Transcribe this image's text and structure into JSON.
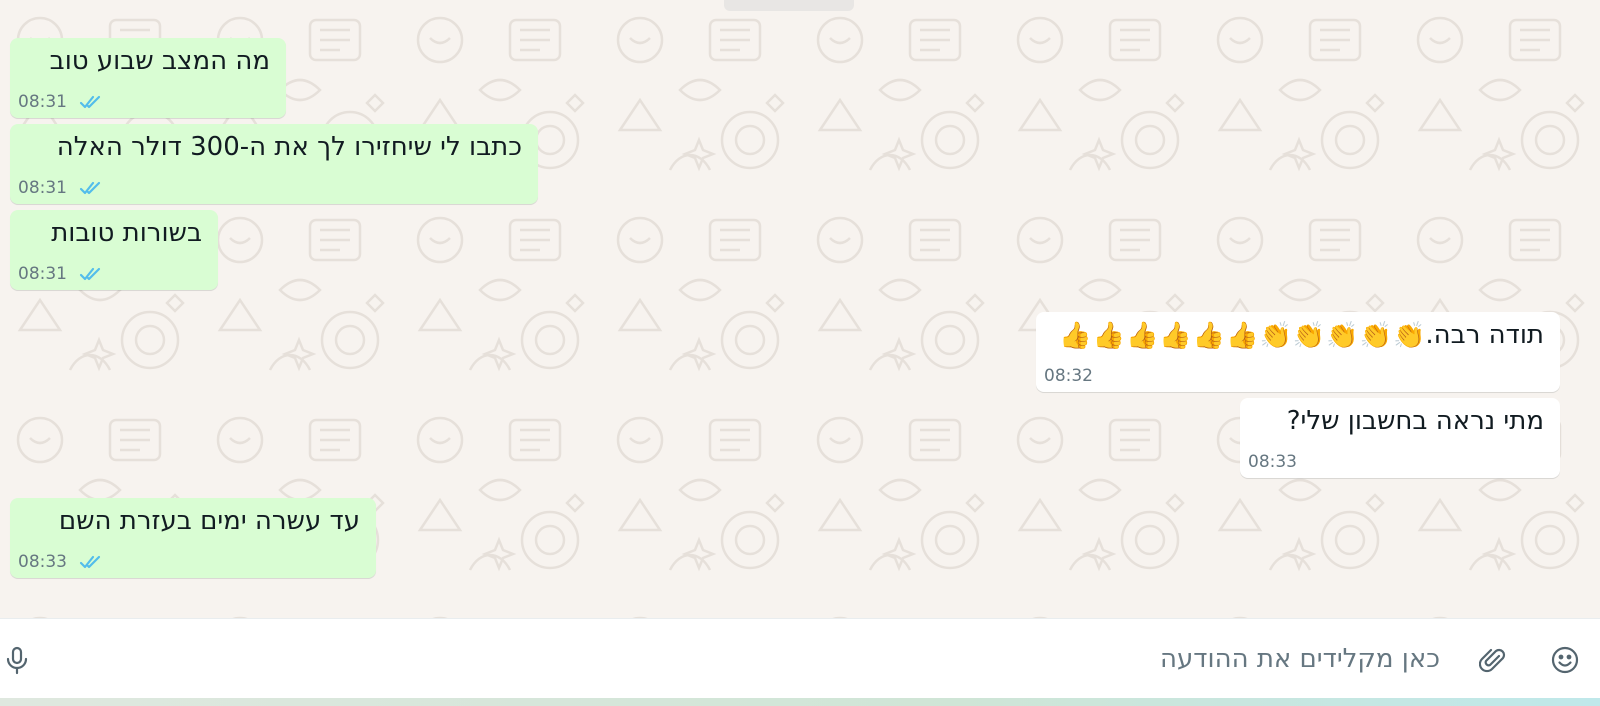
{
  "messages": [
    {
      "text": "מה המצב שבוע טוב",
      "time": "08:31",
      "direction": "outgoing",
      "status": "read"
    },
    {
      "text": "כתבו לי שיחזירו לך את ה-300 דולר האלה",
      "time": "08:31",
      "direction": "outgoing",
      "status": "read"
    },
    {
      "text": "בשורות טובות",
      "time": "08:31",
      "direction": "outgoing",
      "status": "read"
    },
    {
      "text": "תודה רבה.",
      "emoji": [
        "👏",
        "👏",
        "👏",
        "👏",
        "👏",
        "👍",
        "👍",
        "👍",
        "👍",
        "👍",
        "👍"
      ],
      "time": "08:32",
      "direction": "incoming"
    },
    {
      "text": "מתי נראה בחשבון שלי?",
      "time": "08:33",
      "direction": "incoming"
    },
    {
      "text": "עד עשרה ימים בעזרת השם",
      "time": "08:33",
      "direction": "outgoing",
      "status": "read"
    }
  ],
  "composer": {
    "placeholder": "כאן מקלידים את ההודעה",
    "icons": {
      "emoji": "smiley-icon",
      "attach": "paperclip-icon",
      "voice": "microphone-icon"
    }
  },
  "colors": {
    "outgoing_bubble": "#d9fdd3",
    "incoming_bubble": "#ffffff",
    "read_ticks": "#53bdeb",
    "chat_background": "#f7f3ef"
  }
}
